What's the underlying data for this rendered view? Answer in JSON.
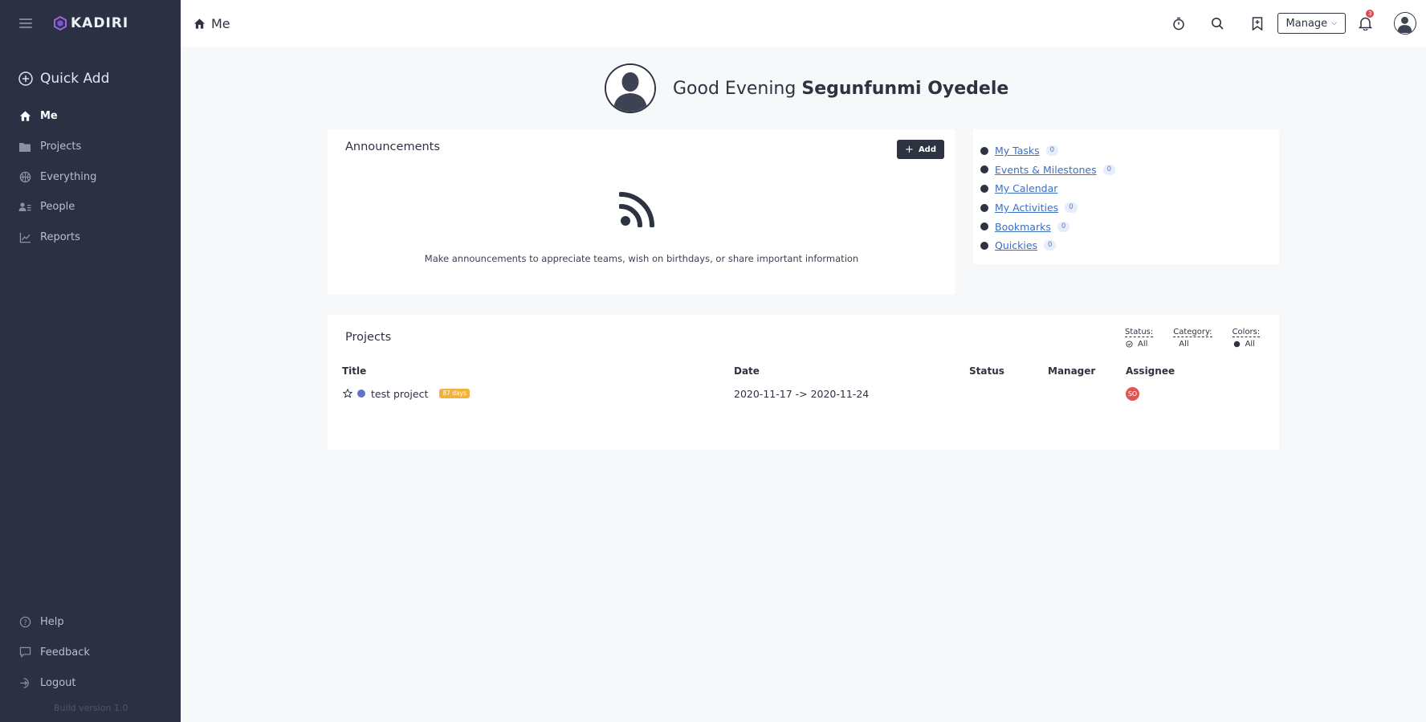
{
  "sidebar": {
    "logo_text": "KADIRI",
    "quick_add": "Quick Add",
    "items": [
      {
        "label": "Me",
        "icon": "home-icon",
        "active": true
      },
      {
        "label": "Projects",
        "icon": "folder-icon"
      },
      {
        "label": "Everything",
        "icon": "basketball-icon"
      },
      {
        "label": "People",
        "icon": "people-icon"
      },
      {
        "label": "Reports",
        "icon": "chart-line-icon"
      }
    ],
    "bottom_items": [
      {
        "label": "Help",
        "icon": "help-icon"
      },
      {
        "label": "Feedback",
        "icon": "feedback-icon"
      },
      {
        "label": "Logout",
        "icon": "logout-icon"
      }
    ],
    "build_version": "Build version 1.0"
  },
  "header": {
    "breadcrumb": "Me",
    "manage_label": "Manage",
    "notification_count": "3"
  },
  "greeting": {
    "prefix": "Good Evening ",
    "name": "Segunfunmi Oyedele"
  },
  "announcements": {
    "title": "Announcements",
    "add_label": "Add",
    "empty_text": "Make announcements to appreciate teams, wish on birthdays, or share important information"
  },
  "quick_links": [
    {
      "label": "My Tasks",
      "count": "0"
    },
    {
      "label": "Events & Milestones",
      "count": "0"
    },
    {
      "label": "My Calendar",
      "count": null
    },
    {
      "label": "My Activities",
      "count": "0"
    },
    {
      "label": "Bookmarks",
      "count": "0"
    },
    {
      "label": "Quickies",
      "count": "0"
    }
  ],
  "projects": {
    "title": "Projects",
    "filters": [
      {
        "label": "Status:",
        "value": "All",
        "icon": "check-circle-icon"
      },
      {
        "label": "Category:",
        "value": "All",
        "icon": null
      },
      {
        "label": "Colors:",
        "value": "All",
        "icon": "color-dot-icon"
      }
    ],
    "columns": [
      "Title",
      "Date",
      "Status",
      "Manager",
      "Assignee"
    ],
    "rows": [
      {
        "title": "test project",
        "badge": "87 days",
        "date": "2020-11-17 -> 2020-11-24",
        "status": "",
        "manager": "",
        "assignee_initials": "SO",
        "dot_color": "#5c74c9"
      }
    ]
  },
  "colors": {
    "sidebar_bg": "#2b3143",
    "accent_dark": "#2d3340",
    "link": "#3b6fc4",
    "badge_orange": "#f1b33b",
    "notification_red": "#e5484d"
  }
}
